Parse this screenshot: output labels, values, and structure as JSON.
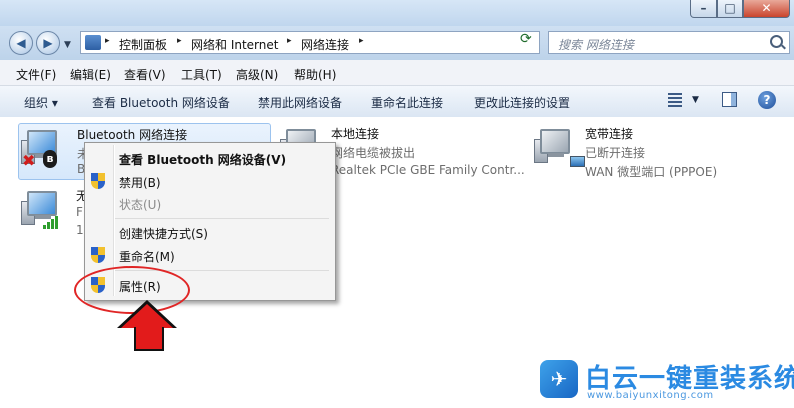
{
  "window": {
    "minimize_glyph": "–",
    "maximize_glyph": "□",
    "close_glyph": "✕"
  },
  "address_bar": {
    "breadcrumbs": [
      "控制面板",
      "网络和 Internet",
      "网络连接"
    ],
    "separator": "▸",
    "refresh_glyph": "⟳"
  },
  "search": {
    "placeholder": "搜索 网络连接"
  },
  "menu": [
    "文件(F)",
    "编辑(E)",
    "查看(V)",
    "工具(T)",
    "高级(N)",
    "帮助(H)"
  ],
  "commands": {
    "organize": "组织 ▾",
    "items": [
      "查看 Bluetooth 网络设备",
      "禁用此网络设备",
      "重命名此连接",
      "更改此连接的设置"
    ],
    "help_glyph": "?"
  },
  "connections": [
    {
      "name": "Bluetooth 网络连接",
      "line1": "未",
      "line2": "B",
      "icon": "bluetooth-pc-icon",
      "selected": true
    },
    {
      "name": "无",
      "line1": "F",
      "line2": "1",
      "icon": "wireless-pc-icon",
      "selected": false
    },
    {
      "name": "本地连接",
      "line1": "网络电缆被拔出",
      "line2": "Realtek PCIe GBE Family Contr...",
      "icon": "local-pc-icon",
      "selected": false
    },
    {
      "name": "宽带连接",
      "line1": "已断开连接",
      "line2": "WAN 微型端口 (PPPOE)",
      "icon": "broadband-pc-icon",
      "selected": false
    }
  ],
  "context_menu": {
    "items": [
      {
        "label": "查看 Bluetooth 网络设备(V)",
        "bold": true,
        "shield": false,
        "disabled": false
      },
      {
        "label": "禁用(B)",
        "bold": false,
        "shield": true,
        "disabled": false
      },
      {
        "label": "状态(U)",
        "bold": false,
        "shield": false,
        "disabled": true
      },
      {
        "label": "创建快捷方式(S)",
        "bold": false,
        "shield": false,
        "disabled": false
      },
      {
        "label": "重命名(M)",
        "bold": false,
        "shield": true,
        "disabled": false
      },
      {
        "label": "属性(R)",
        "bold": false,
        "shield": true,
        "disabled": false
      }
    ]
  },
  "watermark": {
    "title": "白云一键重装系统",
    "url": "www.baiyunxitong.com",
    "logo_glyph": "✈"
  },
  "colors": {
    "accent_red": "#e21b1b",
    "watermark_blue": "#2b8ae2"
  }
}
